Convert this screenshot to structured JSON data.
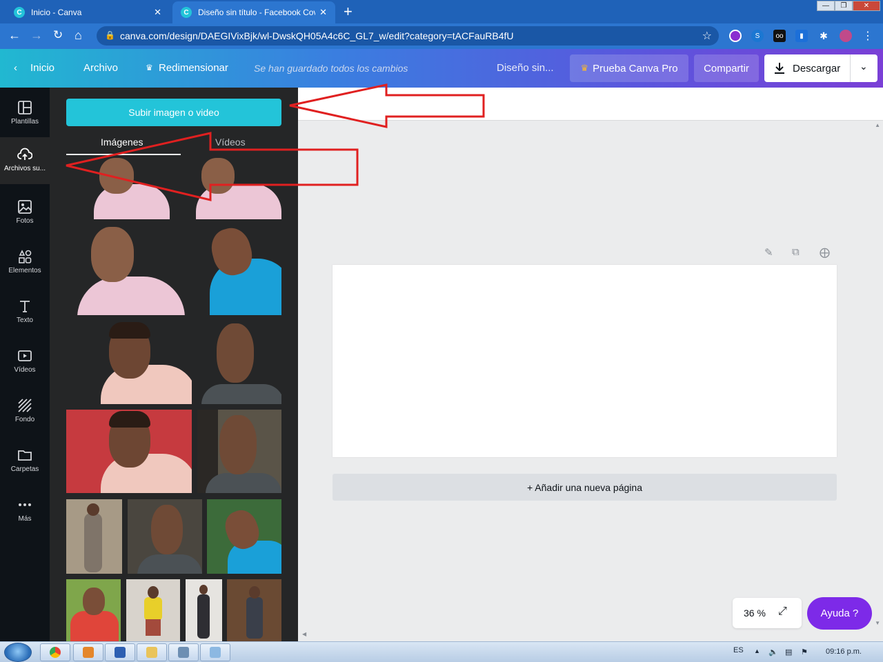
{
  "browser": {
    "tabs": [
      {
        "title": "Inicio - Canva",
        "favicon": "C"
      },
      {
        "title": "Diseño sin título - Facebook Cover",
        "favicon": "C"
      }
    ],
    "new_tab": "+",
    "url": "canva.com/design/DAEGIVixBjk/wl-DwskQH05A4c6C_GL7_w/edit?category=tACFauRB4fU",
    "close": "✕"
  },
  "header": {
    "back_label": "Inicio",
    "file_label": "Archivo",
    "resize_label": "Redimensionar",
    "saved_status": "Se han guardado todos los cambios",
    "design_title": "Diseño sin...",
    "pro_label": "Prueba Canva Pro",
    "share_label": "Compartir",
    "download_label": "Descargar"
  },
  "rail": {
    "items": [
      {
        "label": "Plantillas",
        "icon": "templates-icon"
      },
      {
        "label": "Archivos su...",
        "icon": "upload-cloud-icon"
      },
      {
        "label": "Fotos",
        "icon": "photo-icon"
      },
      {
        "label": "Elementos",
        "icon": "shapes-icon"
      },
      {
        "label": "Texto",
        "icon": "text-icon"
      },
      {
        "label": "Vídeos",
        "icon": "video-icon"
      },
      {
        "label": "Fondo",
        "icon": "background-icon"
      },
      {
        "label": "Carpetas",
        "icon": "folder-icon"
      },
      {
        "label": "Más",
        "icon": "more-icon"
      }
    ]
  },
  "panel": {
    "upload_button": "Subir imagen o video",
    "tabs": [
      "Imágenes",
      "Vídeos"
    ]
  },
  "canvas": {
    "add_page": "+ Añadir una nueva página",
    "zoom": "36 %",
    "help": "Ayuda ?"
  },
  "taskbar": {
    "lang": "ES",
    "time": "09:16 p.m."
  },
  "colors": {
    "brand_teal": "#23c4d9",
    "brand_purple": "#7d2ae8",
    "annotation_red": "#e02020"
  }
}
